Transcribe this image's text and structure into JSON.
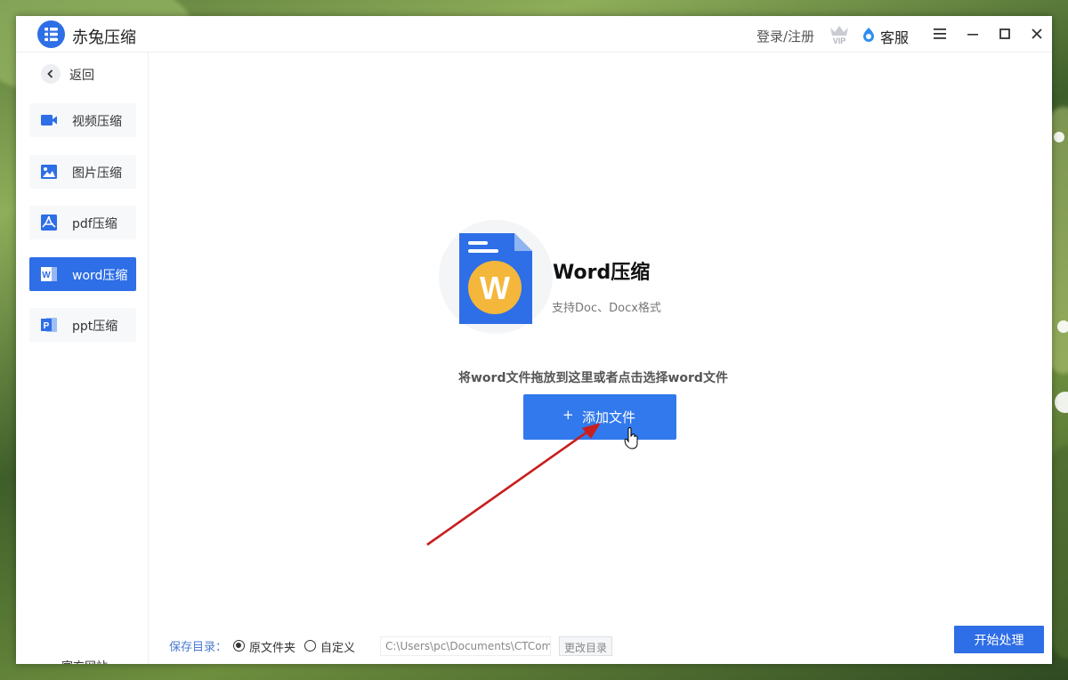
{
  "app": {
    "title": "赤兔压缩",
    "accent_color": "#2e6ee6",
    "logo_icon": "app-logo-icon"
  },
  "titlebar": {
    "login_label": "登录/注册",
    "vip_badge_label": "VIP",
    "service_label": "客服",
    "menu_icon": "hamburger-menu-icon",
    "minimize_icon": "minimize-icon",
    "maximize_icon": "maximize-icon",
    "close_icon": "close-icon"
  },
  "sidebar": {
    "back_label": "返回",
    "items": [
      {
        "label": "视频压缩",
        "icon": "video-icon",
        "active": false
      },
      {
        "label": "图片压缩",
        "icon": "image-icon",
        "active": false
      },
      {
        "label": "pdf压缩",
        "icon": "pdf-icon",
        "active": false
      },
      {
        "label": "word压缩",
        "icon": "word-icon",
        "active": true
      },
      {
        "label": "ppt压缩",
        "icon": "ppt-icon",
        "active": false
      }
    ],
    "official_site_label": "官方网站"
  },
  "main": {
    "feature_title": "Word压缩",
    "feature_subtitle": "支持Doc、Docx格式",
    "doc_letter": "W",
    "drop_hint": "将word文件拖放到这里或者点击选择word文件",
    "add_button_plus": "+",
    "add_button_label": "添加文件"
  },
  "save": {
    "label": "保存目录：",
    "options": [
      {
        "label": "原文件夹",
        "checked": true
      },
      {
        "label": "自定义",
        "checked": false
      }
    ],
    "path_value": "C:\\Users\\pc\\Documents\\CTCom",
    "change_dir_label": "更改目录"
  },
  "start_button_label": "开始处理"
}
